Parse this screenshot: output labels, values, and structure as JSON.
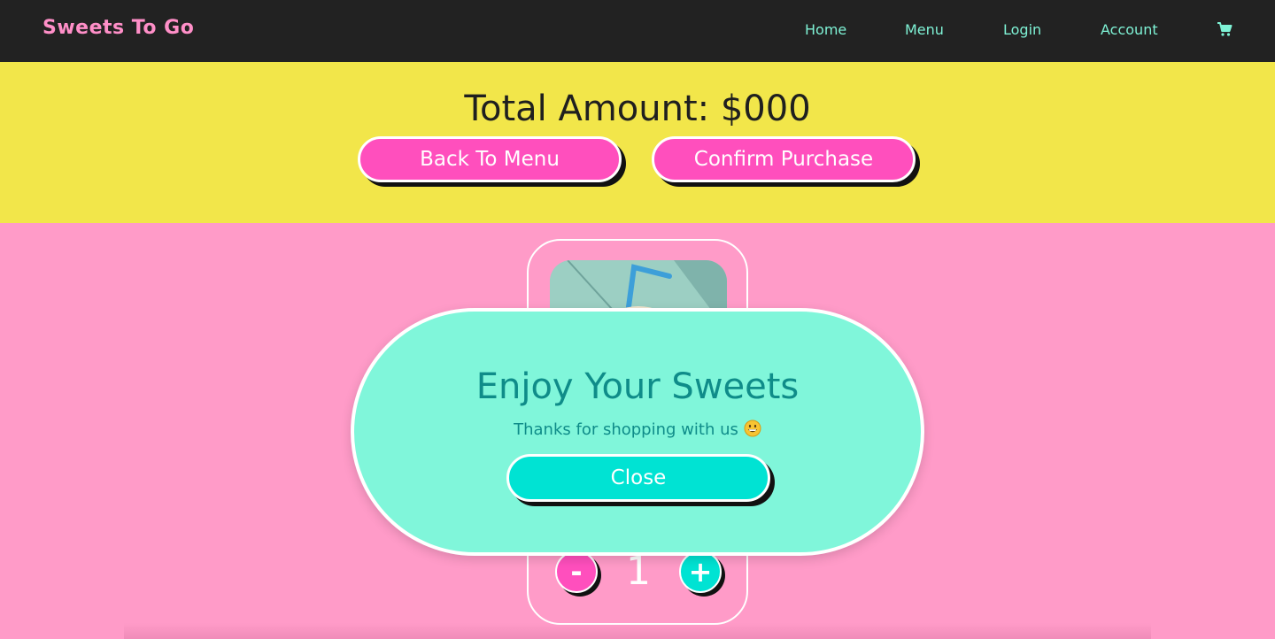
{
  "header": {
    "brand": "Sweets To Go",
    "nav": [
      "Home",
      "Menu",
      "Login",
      "Account"
    ],
    "cart_icon": "shopping-cart-icon"
  },
  "summary": {
    "total_label": "Total Amount: $000",
    "back_button": "Back To Menu",
    "confirm_button": "Confirm Purchase"
  },
  "product": {
    "quantity": "1",
    "minus_label": "-",
    "plus_label": "+"
  },
  "modal": {
    "title": "Enjoy Your Sweets",
    "message": "Thanks for shopping with us",
    "emoji_icon": "grinning-face-icon",
    "close_button": "Close"
  },
  "colors": {
    "navbar": "#222222",
    "brand": "#ff8fc8",
    "nav_link": "#7ff3d6",
    "summary_band": "#f2e64a",
    "page_background": "#ff9bc8",
    "pink_button": "#ff4fbd",
    "teal_button": "#00e3d3",
    "modal_background": "#80f6da",
    "modal_text": "#0f8c89"
  }
}
